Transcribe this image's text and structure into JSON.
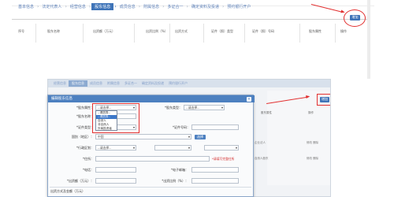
{
  "steps_top": [
    {
      "label": "基本信息",
      "active": false
    },
    {
      "label": "法定代表人",
      "active": false
    },
    {
      "label": "经营信息",
      "active": false
    },
    {
      "label": "股东信息",
      "active": true
    },
    {
      "label": "成员信息",
      "active": false
    },
    {
      "label": "附属信息",
      "active": false
    },
    {
      "label": "多证合一",
      "active": false
    },
    {
      "label": "确定资料及投递",
      "active": false
    },
    {
      "label": "预约银行开户",
      "active": false
    }
  ],
  "table_top": {
    "headers": [
      "序号",
      "股东名称",
      "出资额（万元）",
      "出资比例（%）",
      "出资方式",
      "证件（照）类型",
      "证件（照）号码",
      "股东属性",
      "操作"
    ]
  },
  "add_button_label": "增加",
  "steps_lower": [
    {
      "label": "经营信息",
      "active": false
    },
    {
      "label": "股东信息",
      "active": true
    },
    {
      "label": "成员信息",
      "active": false
    },
    {
      "label": "附属信息",
      "active": false
    },
    {
      "label": "多证合一",
      "active": false
    },
    {
      "label": "确定资料及投递",
      "active": false
    },
    {
      "label": "预约银行开户",
      "active": false
    }
  ],
  "lower_right": {
    "header_attr": "股东属性",
    "header_op": "操作",
    "rows": [
      {
        "attr": "企业法人",
        "op": "修改 删除"
      },
      {
        "attr": "自然人股东",
        "op": "修改 删除"
      }
    ]
  },
  "dialog": {
    "title": "编辑股东信息",
    "close_label": "×",
    "fields": {
      "shareholder_attr": {
        "label": "*股东属性：",
        "value": "--请选择--"
      },
      "shareholder_type": {
        "label": "*股东类型：",
        "value": "--请选择--"
      },
      "shareholder_name": {
        "label": "*股东名称："
      },
      "cert_type": {
        "label": "*证件类型："
      },
      "cert_no": {
        "label": "*证件号码："
      },
      "country": {
        "label": "国别（地区）：",
        "value": "中国"
      },
      "select_button": "选择",
      "region": {
        "label": "*行政区划：",
        "value": "--请选择--"
      },
      "address": {
        "label": "*住所："
      },
      "address_hint": "*请填写完整住所",
      "phone": {
        "label": "*电话："
      },
      "email": {
        "label": "*电子邮箱："
      },
      "capital": {
        "label": "*出资额（万元）："
      },
      "ratio": {
        "label": "*出资比例（%）："
      },
      "section_title": "出资方式及金额（万元）"
    },
    "dropdown_options": [
      {
        "label": "--请选择--",
        "highlighted": false
      },
      {
        "label": "--请选择--",
        "highlighted": true
      },
      {
        "label": "自然人",
        "highlighted": false
      },
      {
        "label": "非自然人",
        "highlighted": false
      },
      {
        "label": "外商投资者",
        "highlighted": false
      }
    ]
  },
  "colors": {
    "active_step": "#3f74b8",
    "annotation": "#e23030",
    "dialog_title": "#4d80c0"
  }
}
